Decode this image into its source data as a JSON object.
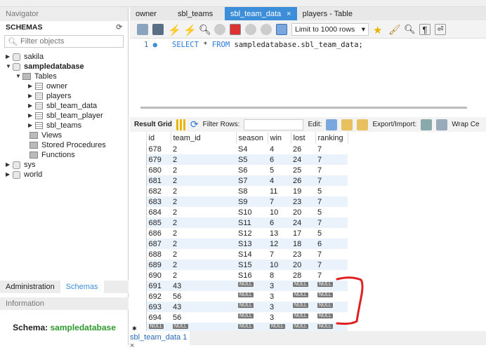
{
  "navigator": {
    "title": "Navigator",
    "schemas_label": "SCHEMAS",
    "filter_placeholder": "Filter objects",
    "tree": [
      {
        "label": "sakila",
        "expanded": false
      },
      {
        "label": "sampledatabase",
        "expanded": true,
        "children": {
          "tables_label": "Tables",
          "tables": [
            "owner",
            "players",
            "sbl_team_data",
            "sbl_team_player",
            "sbl_teams"
          ],
          "views": "Views",
          "procs": "Stored Procedures",
          "funcs": "Functions"
        }
      },
      {
        "label": "sys",
        "expanded": false
      },
      {
        "label": "world",
        "expanded": false
      }
    ],
    "bottom_tabs": [
      "Administration",
      "Schemas"
    ],
    "info_title": "Information",
    "schema_label": "Schema:",
    "schema_value": "sampledatabase"
  },
  "editor_tabs": [
    {
      "label": "owner"
    },
    {
      "label": "sbl_teams"
    },
    {
      "label": "sbl_team_data",
      "active": true
    },
    {
      "label": "players - Table"
    }
  ],
  "toolbar": {
    "limit": "Limit to 1000 rows"
  },
  "editor": {
    "line": "1",
    "sql_kw1": "SELECT",
    "sql_mid": " * ",
    "sql_kw2": "FROM",
    "sql_rest": " sampledatabase.sbl_team_data;"
  },
  "result_toolbar": {
    "grid": "Result Grid",
    "filter": "Filter Rows:",
    "edit": "Edit:",
    "export": "Export/Import:",
    "wrap": "Wrap Ce"
  },
  "grid": {
    "columns": [
      "id",
      "team_id",
      "season",
      "win",
      "lost",
      "ranking"
    ],
    "rows": [
      [
        "678",
        "2",
        "S4",
        "4",
        "26",
        "7"
      ],
      [
        "679",
        "2",
        "S5",
        "6",
        "24",
        "7"
      ],
      [
        "680",
        "2",
        "S6",
        "5",
        "25",
        "7"
      ],
      [
        "681",
        "2",
        "S7",
        "4",
        "26",
        "7"
      ],
      [
        "682",
        "2",
        "S8",
        "11",
        "19",
        "5"
      ],
      [
        "683",
        "2",
        "S9",
        "7",
        "23",
        "7"
      ],
      [
        "684",
        "2",
        "S10",
        "10",
        "20",
        "5"
      ],
      [
        "685",
        "2",
        "S11",
        "6",
        "24",
        "7"
      ],
      [
        "686",
        "2",
        "S12",
        "13",
        "17",
        "5"
      ],
      [
        "687",
        "2",
        "S13",
        "12",
        "18",
        "6"
      ],
      [
        "688",
        "2",
        "S14",
        "7",
        "23",
        "7"
      ],
      [
        "689",
        "2",
        "S15",
        "10",
        "20",
        "7"
      ],
      [
        "690",
        "2",
        "S16",
        "8",
        "28",
        "7"
      ],
      [
        "691",
        "43",
        "NULL",
        "3",
        "NULL",
        "NULL"
      ],
      [
        "692",
        "56",
        "NULL",
        "3",
        "NULL",
        "NULL"
      ],
      [
        "693",
        "43",
        "NULL",
        "3",
        "NULL",
        "NULL"
      ],
      [
        "694",
        "56",
        "NULL",
        "3",
        "NULL",
        "NULL"
      ],
      [
        "NULL",
        "NULL",
        "NULL",
        "NULL",
        "NULL",
        "NULL"
      ]
    ]
  },
  "result_tab": "sbl_team_data 1",
  "colors": {
    "accent": "#3c8ed8",
    "annotation": "#e02020",
    "schema": "#2e9a2e"
  }
}
